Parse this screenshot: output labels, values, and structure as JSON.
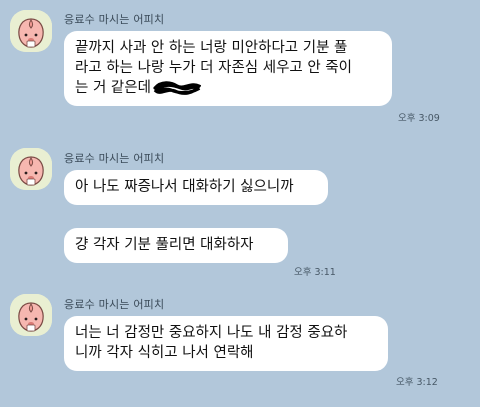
{
  "chat": {
    "groups": [
      {
        "sender": "응료수 마시는 어피치",
        "messages": [
          {
            "lines": [
              "끝까지 사과 안 하는 너랑 미안하다고 기분 풀",
              "라고 하는 나랑 누가 더 자존심 세우고 안 죽이",
              "는 거 같은데"
            ],
            "has_redaction": true,
            "time": "오후 3:09"
          }
        ]
      },
      {
        "sender": "응료수 마시는 어피치",
        "messages": [
          {
            "lines": [
              "아 나도 짜증나서 대화하기 싫으니까"
            ],
            "time": ""
          },
          {
            "lines": [
              "걍 각자 기분 풀리면 대화하자"
            ],
            "time": "오후 3:11"
          }
        ]
      },
      {
        "sender": "응료수 마시는 어피치",
        "messages": [
          {
            "lines": [
              "너는 너 감정만 중요하지 나도 내 감정 중요하",
              "니까 각자 식히고 나서 연락해"
            ],
            "time": "오후 3:12"
          }
        ]
      }
    ]
  },
  "colors": {
    "background": "#b2c7da",
    "bubble": "#ffffff",
    "avatar_bg": "#e9efd2"
  },
  "icons": {
    "avatar": "apeach-character-icon",
    "redaction": "scribble-redaction"
  }
}
